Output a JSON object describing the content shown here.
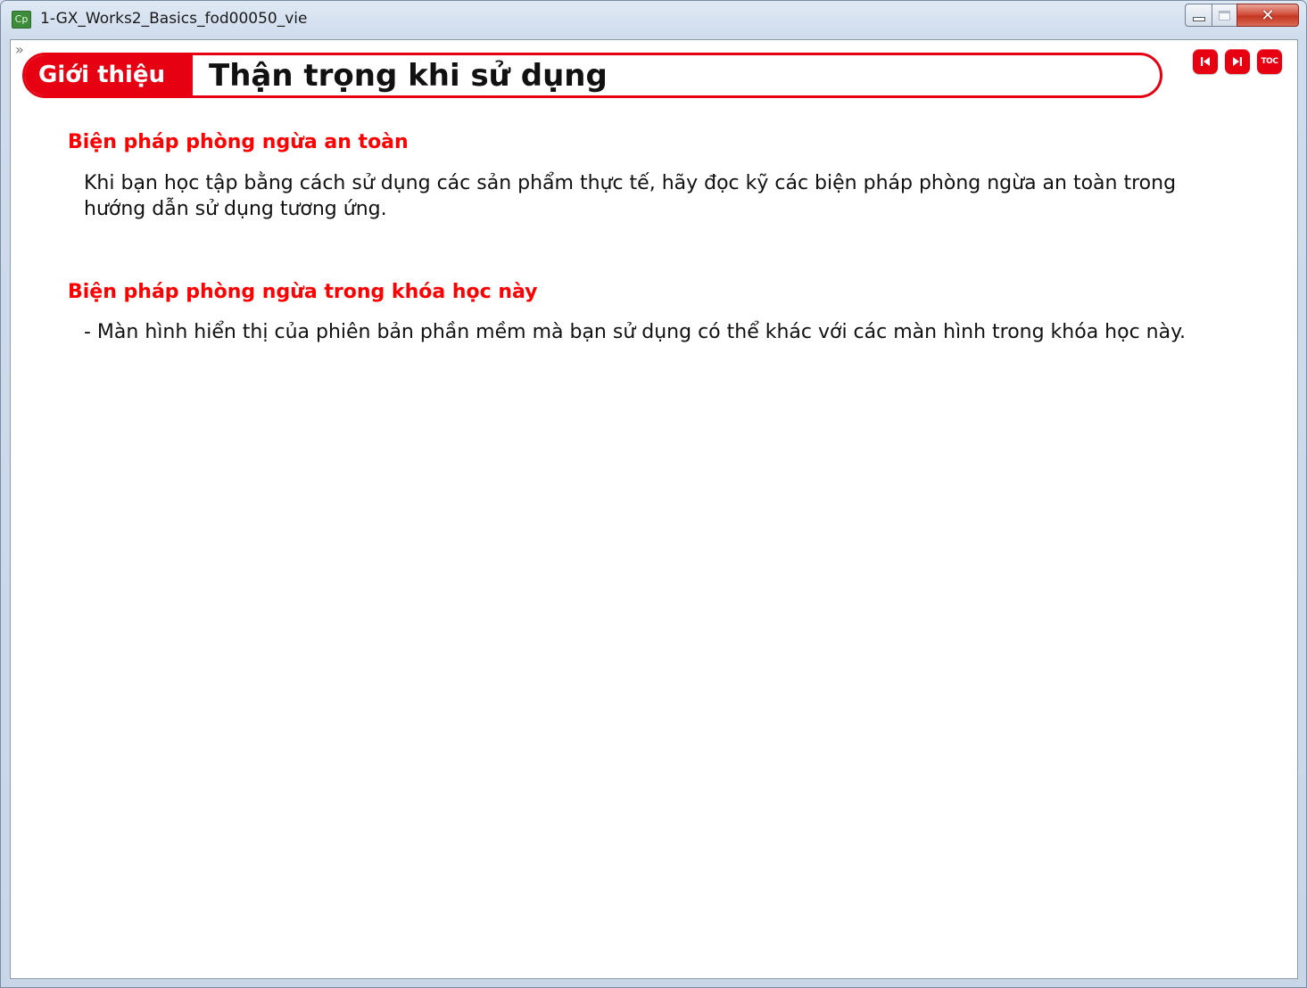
{
  "window": {
    "title": "1-GX_Works2_Basics_fod00050_vie",
    "app_icon_label": "Cp",
    "controls": {
      "minimize_icon": "minimize-icon",
      "maximize_icon": "maximize-icon",
      "close_glyph": "✕"
    }
  },
  "sidebar_toggle": {
    "glyph": "»"
  },
  "header": {
    "section": "Giới thiệu",
    "title": "Thận trọng khi sử dụng"
  },
  "nav": {
    "previous_icon": "skip-back-icon",
    "next_icon": "skip-forward-icon",
    "toc_label": "TOC"
  },
  "content": {
    "sections": [
      {
        "heading": "Biện pháp phòng ngừa an toàn",
        "body": "Khi bạn học tập bằng cách sử dụng các sản phẩm thực tế, hãy đọc kỹ các biện pháp phòng ngừa an toàn trong hướng dẫn sử dụng tương ứng."
      },
      {
        "heading": "Biện pháp phòng ngừa trong khóa học này",
        "body": "- Màn hình hiển thị của phiên bản phần mềm mà bạn sử dụng có thể khác với các màn hình trong khóa học này."
      }
    ]
  },
  "colors": {
    "accent": "#e60012",
    "heading": "#ff0000",
    "text": "#111111",
    "background": "#ffffff"
  }
}
